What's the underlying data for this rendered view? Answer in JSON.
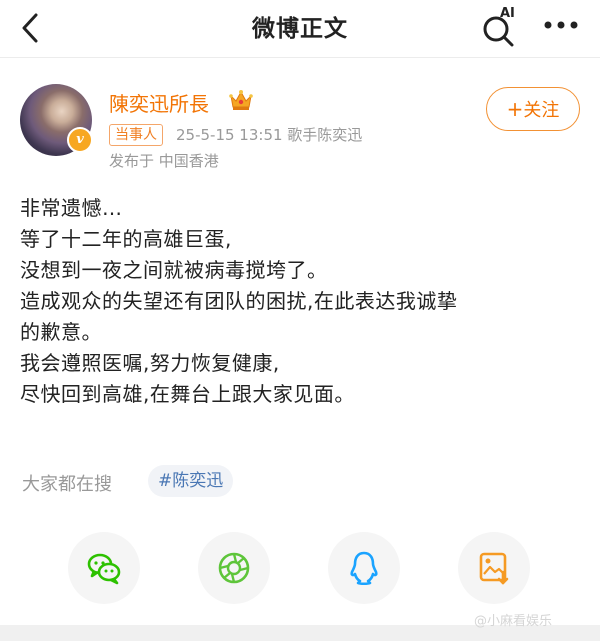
{
  "header": {
    "title": "微博正文",
    "ai_label": "AI"
  },
  "post": {
    "author": "陳奕迅所長",
    "tag": "当事人",
    "meta": "25-5-15 13:51  歌手陈奕迅",
    "location": "发布于 中国香港",
    "follow_label": "关注",
    "content_lines": [
      "非常遗憾…",
      "等了十二年的高雄巨蛋,",
      "没想到一夜之间就被病毒搅垮了。",
      "造成观众的失望还有团队的困扰,在此表达我诚挚",
      "的歉意。",
      "我会遵照医嘱,努力恢复健康,",
      "尽快回到高雄,在舞台上跟大家见面。"
    ]
  },
  "search": {
    "label": "大家都在搜",
    "topic": "#陈奕迅"
  },
  "share": {
    "items": [
      "wechat-icon",
      "moments-icon",
      "qq-icon",
      "save-image-icon"
    ]
  },
  "colors": {
    "brand_orange": "#f27405",
    "topic_blue": "#4a77b4",
    "wechat_green": "#2dc100",
    "qq_blue": "#1aa3ff",
    "save_orange": "#f59a23"
  },
  "watermark": "@小麻看娱乐"
}
